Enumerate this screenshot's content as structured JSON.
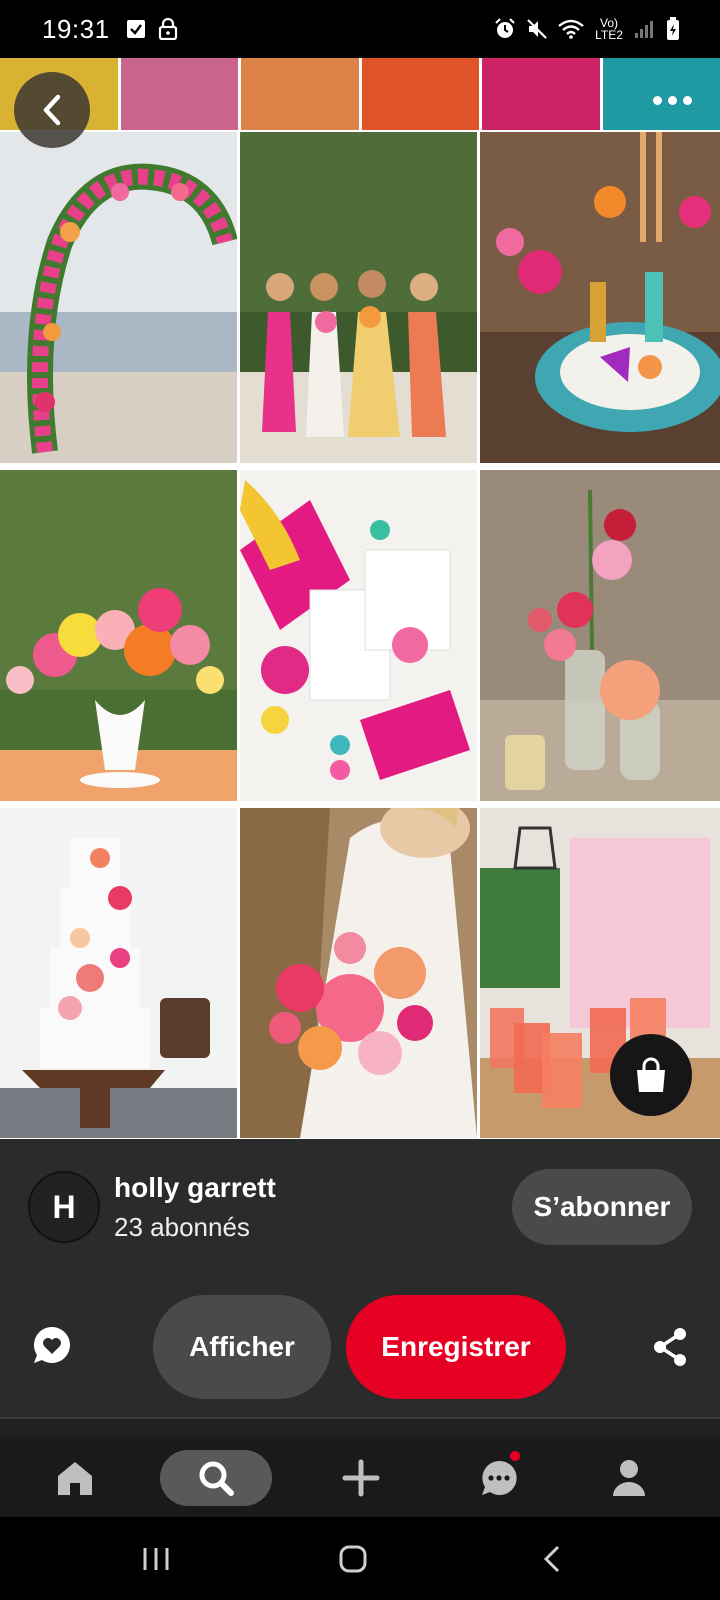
{
  "status_bar": {
    "time": "19:31",
    "network_label": "Vo) LTE2",
    "icons": [
      "checkbox-notification-icon",
      "lock-icon",
      "alarm-icon",
      "mute-icon",
      "wifi-icon",
      "signal-icon",
      "battery-icon"
    ]
  },
  "pin": {
    "palette_colors": [
      "#d9b233",
      "#c9648a",
      "#de8347",
      "#e0532a",
      "#cc2266",
      "#1f9aa2"
    ],
    "images": [
      {
        "name": "flower-arch-image",
        "bg": "#d8dde2"
      },
      {
        "name": "bridesmaids-image",
        "bg": "#5f7a48"
      },
      {
        "name": "table-setting-image",
        "bg": "#8a6a50"
      },
      {
        "name": "centerpiece-image",
        "bg": "#6f8a4c"
      },
      {
        "name": "invitation-flatlay-image",
        "bg": "#f2f1ef"
      },
      {
        "name": "bud-vases-image",
        "bg": "#9b8a78"
      },
      {
        "name": "wedding-cake-image",
        "bg": "#eef0f0"
      },
      {
        "name": "bride-bouquet-image",
        "bg": "#b89a78"
      },
      {
        "name": "cocktails-image",
        "bg": "#d9cdc0"
      }
    ]
  },
  "creator": {
    "initial": "H",
    "name": "holly garrett",
    "followers": "23 abonnés",
    "follow_label": "S’abonner"
  },
  "actions": {
    "view_label": "Afficher",
    "save_label": "Enregistrer"
  },
  "colors": {
    "accent": "#e60023",
    "panel": "#2b2b2b",
    "button": "#4a4a4a"
  },
  "bottom_nav": [
    "home",
    "search",
    "create",
    "messages",
    "profile"
  ],
  "bottom_nav_active": "search"
}
